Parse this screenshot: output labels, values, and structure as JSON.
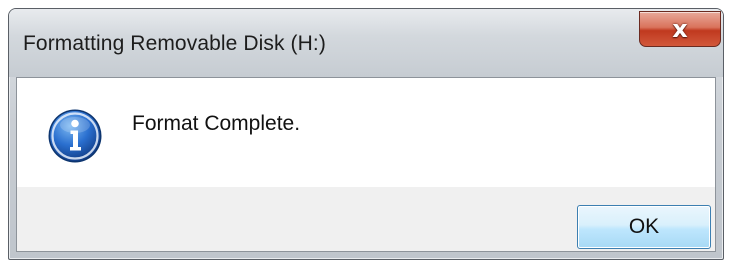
{
  "window": {
    "title": "Formatting Removable Disk (H:)",
    "close_label": "x"
  },
  "dialog": {
    "icon": "info-icon",
    "message": "Format Complete.",
    "ok_label": "OK"
  },
  "colors": {
    "close_button": "#c94f33",
    "ok_button_border": "#3c7fb1",
    "info_icon_blue": "#1f5fb8"
  }
}
